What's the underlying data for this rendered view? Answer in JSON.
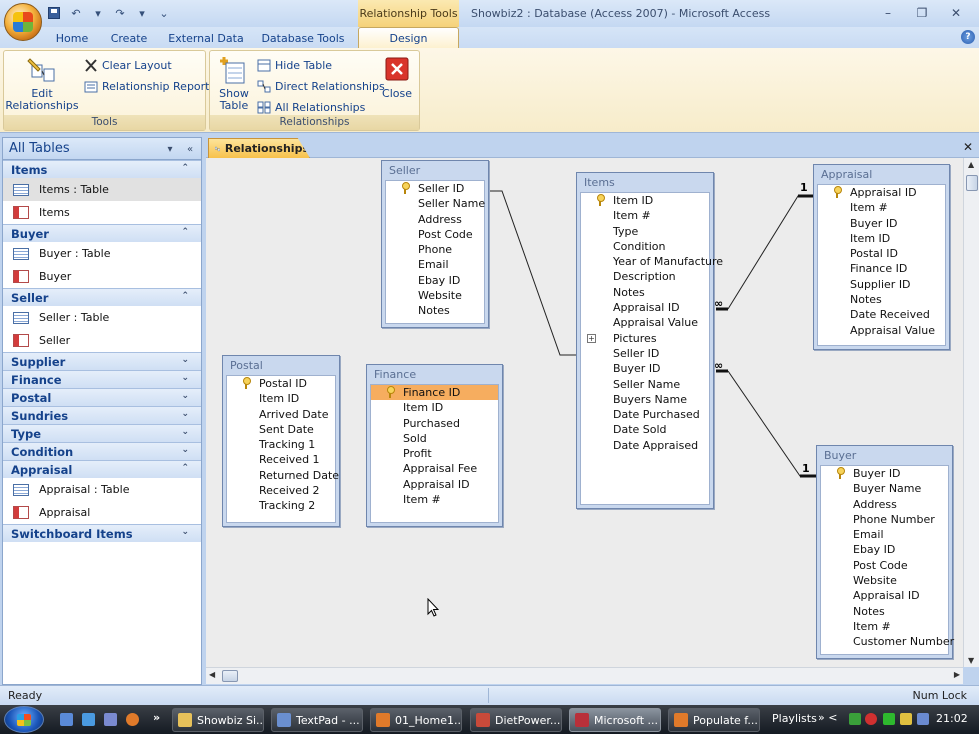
{
  "window": {
    "context_tab_title": "Relationship Tools",
    "title": "Showbiz2 : Database (Access 2007) - Microsoft Access",
    "minimize_glyph": "–",
    "maximize_glyph": "❐",
    "close_glyph": "✕"
  },
  "qat": {
    "undo_glyph": "↶",
    "redo_glyph": "↷",
    "dropdown_glyph": "▾",
    "customize_glyph": "⌄"
  },
  "ribbon_tabs": [
    {
      "label": "Home"
    },
    {
      "label": "Create"
    },
    {
      "label": "External Data"
    },
    {
      "label": "Database Tools"
    },
    {
      "label": "Design"
    }
  ],
  "active_tab": "Design",
  "ribbon": {
    "tools_group": {
      "label": "Tools",
      "edit_relationships": "Edit Relationships",
      "clear_layout": "Clear Layout",
      "relationship_report": "Relationship Report"
    },
    "relationships_group": {
      "label": "Relationships",
      "show_table": "Show Table",
      "hide_table": "Hide Table",
      "direct_relationships": "Direct Relationships",
      "all_relationships": "All Relationships",
      "close": "Close"
    }
  },
  "nav_pane": {
    "title": "All Tables",
    "groups": [
      {
        "label": "Items",
        "expanded": true,
        "items": [
          {
            "label": "Items : Table",
            "type": "table",
            "selected": true
          },
          {
            "label": "Items",
            "type": "form"
          }
        ]
      },
      {
        "label": "Buyer",
        "expanded": true,
        "items": [
          {
            "label": "Buyer : Table",
            "type": "table"
          },
          {
            "label": "Buyer",
            "type": "form"
          }
        ]
      },
      {
        "label": "Seller",
        "expanded": true,
        "items": [
          {
            "label": "Seller : Table",
            "type": "table"
          },
          {
            "label": "Seller",
            "type": "form"
          }
        ]
      },
      {
        "label": "Supplier",
        "expanded": false,
        "items": []
      },
      {
        "label": "Finance",
        "expanded": false,
        "items": []
      },
      {
        "label": "Postal",
        "expanded": false,
        "items": []
      },
      {
        "label": "Sundries",
        "expanded": false,
        "items": []
      },
      {
        "label": "Type",
        "expanded": false,
        "items": []
      },
      {
        "label": "Condition",
        "expanded": false,
        "items": []
      },
      {
        "label": "Appraisal",
        "expanded": true,
        "items": [
          {
            "label": "Appraisal : Table",
            "type": "table"
          },
          {
            "label": "Appraisal",
            "type": "form"
          }
        ]
      },
      {
        "label": "Switchboard Items",
        "expanded": false,
        "items": []
      }
    ]
  },
  "document_tab": {
    "label": "Relationships",
    "close_glyph": "✕"
  },
  "field_lists": {
    "seller": {
      "title": "Seller",
      "fields": [
        {
          "name": "Seller ID",
          "key": true
        },
        {
          "name": "Seller Name"
        },
        {
          "name": "Address"
        },
        {
          "name": "Post Code"
        },
        {
          "name": "Phone"
        },
        {
          "name": "Email"
        },
        {
          "name": "Ebay ID"
        },
        {
          "name": "Website"
        },
        {
          "name": "Notes"
        }
      ]
    },
    "items": {
      "title": "Items",
      "fields": [
        {
          "name": "Item ID",
          "key": true
        },
        {
          "name": "Item #"
        },
        {
          "name": "Type"
        },
        {
          "name": "Condition"
        },
        {
          "name": "Year of Manufacture"
        },
        {
          "name": "Description"
        },
        {
          "name": "Notes"
        },
        {
          "name": "Appraisal ID"
        },
        {
          "name": "Appraisal Value"
        },
        {
          "name": "Pictures",
          "expandable": true
        },
        {
          "name": "Seller ID"
        },
        {
          "name": "Buyer ID"
        },
        {
          "name": "Seller Name"
        },
        {
          "name": "Buyers Name"
        },
        {
          "name": "Date Purchased"
        },
        {
          "name": "Date Sold"
        },
        {
          "name": "Date Appraised"
        }
      ]
    },
    "appraisal": {
      "title": "Appraisal",
      "fields": [
        {
          "name": "Appraisal ID",
          "key": true
        },
        {
          "name": "Item #"
        },
        {
          "name": "Buyer ID"
        },
        {
          "name": "Item ID"
        },
        {
          "name": "Postal ID"
        },
        {
          "name": "Finance ID"
        },
        {
          "name": "Supplier ID"
        },
        {
          "name": "Notes"
        },
        {
          "name": "Date Received"
        },
        {
          "name": "Appraisal Value"
        }
      ]
    },
    "postal": {
      "title": "Postal",
      "fields": [
        {
          "name": "Postal ID",
          "key": true
        },
        {
          "name": "Item ID"
        },
        {
          "name": "Arrived Date"
        },
        {
          "name": "Sent Date"
        },
        {
          "name": "Tracking 1"
        },
        {
          "name": "Received 1"
        },
        {
          "name": "Returned Date"
        },
        {
          "name": "Received 2"
        },
        {
          "name": "Tracking 2"
        }
      ]
    },
    "finance": {
      "title": "Finance",
      "fields": [
        {
          "name": "Finance ID",
          "key": true,
          "selected": true
        },
        {
          "name": "Item ID"
        },
        {
          "name": "Purchased"
        },
        {
          "name": "Sold"
        },
        {
          "name": "Profit"
        },
        {
          "name": "Appraisal Fee"
        },
        {
          "name": "Appraisal ID"
        },
        {
          "name": "Item #"
        }
      ]
    },
    "buyer": {
      "title": "Buyer",
      "fields": [
        {
          "name": "Buyer ID",
          "key": true
        },
        {
          "name": "Buyer Name"
        },
        {
          "name": "Address"
        },
        {
          "name": "Phone Number"
        },
        {
          "name": "Email"
        },
        {
          "name": "Ebay ID"
        },
        {
          "name": "Post Code"
        },
        {
          "name": "Website"
        },
        {
          "name": "Appraisal ID"
        },
        {
          "name": "Notes"
        },
        {
          "name": "Item #"
        },
        {
          "name": "Customer Number"
        }
      ]
    }
  },
  "relationship_labels": {
    "one": "1",
    "many": "∞"
  },
  "status": {
    "left": "Ready",
    "right": "Num Lock"
  },
  "taskbar": {
    "overflow_glyph": "»",
    "buttons": [
      {
        "label": "Showbiz Si...",
        "color": "#e7c15a"
      },
      {
        "label": "TextPad - ...",
        "color": "#6a8fd0"
      },
      {
        "label": "01_Home1...",
        "color": "#e07a2a"
      },
      {
        "label": "DietPower...",
        "color": "#c84a3a"
      },
      {
        "label": "Microsoft ...",
        "color": "#b8303a",
        "active": true
      },
      {
        "label": "Populate f...",
        "color": "#e07a2a"
      }
    ],
    "playlists": "Playlists",
    "tray_arrows": "» <",
    "clock": "21:02"
  }
}
